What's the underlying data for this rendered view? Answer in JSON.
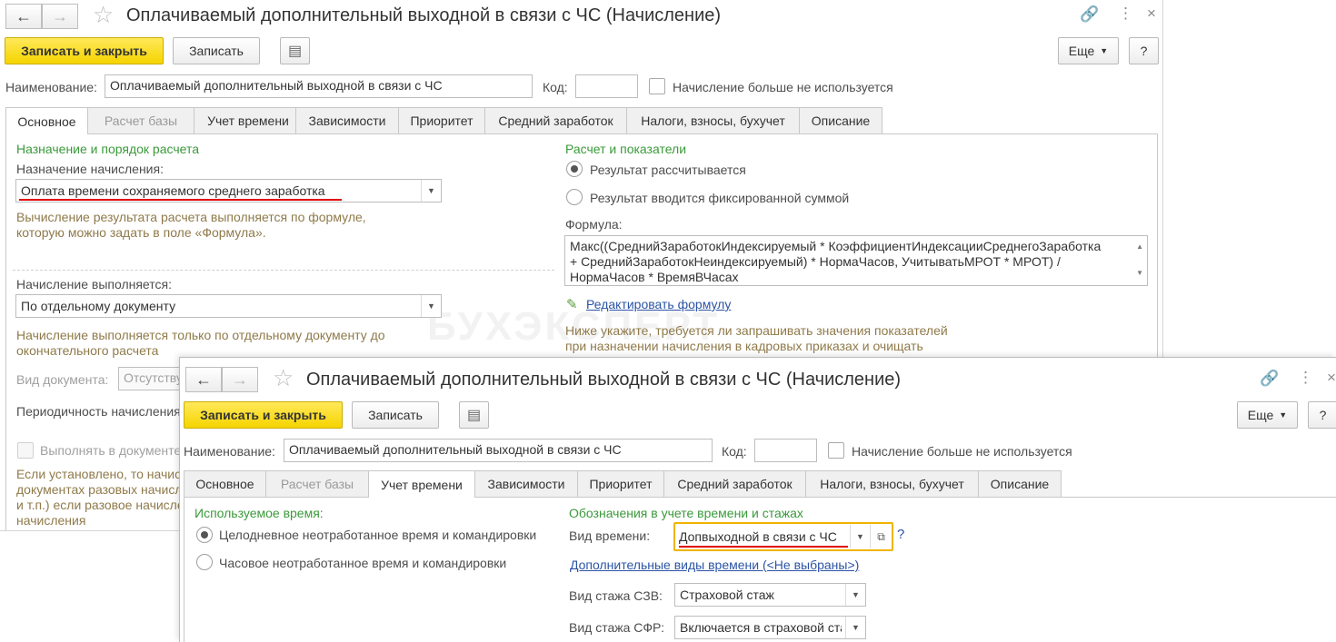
{
  "win1": {
    "title": "Оплачиваемый дополнительный выходной в связи с ЧС (Начисление)",
    "toolbar": {
      "save_close": "Записать и закрыть",
      "save": "Записать",
      "more": "Еще",
      "help": "?"
    },
    "name_label": "Наименование:",
    "name_value": "Оплачиваемый дополнительный выходной в связи с ЧС",
    "code_label": "Код:",
    "code_value": "",
    "unused_label": "Начисление больше не используется",
    "tabs": [
      "Основное",
      "Расчет базы",
      "Учет времени",
      "Зависимости",
      "Приоритет",
      "Средний заработок",
      "Налоги, взносы, бухучет",
      "Описание"
    ],
    "left": {
      "section": "Назначение и порядок расчета",
      "purpose_label": "Назначение начисления:",
      "purpose_value": "Оплата времени сохраняемого среднего заработка",
      "hint1_line1": "Вычисление результата расчета выполняется по формуле,",
      "hint1_line2": "которую можно задать в поле «Формула».",
      "exec_label": "Начисление выполняется:",
      "exec_value": "По отдельному документу",
      "hint2_line1": "Начисление выполняется только по отдельному документу до",
      "hint2_line2": "окончательного расчета",
      "doc_type_label": "Вид документа:",
      "doc_type_value": "Отсутствует",
      "period_label": "Периодичность начисления:",
      "exec_in_doc_label": "Выполнять в документе",
      "hint3_line1": "Если установлено, то начисление",
      "hint3_line2": "документах разовых начислений",
      "hint3_line3": "и т.п.) если разовое начисление",
      "hint3_line4": "начисления"
    },
    "right": {
      "section": "Расчет и показатели",
      "radio1": "Результат рассчитывается",
      "radio2": "Результат вводится фиксированной суммой",
      "formula_label": "Формула:",
      "formula_line1": "Макс((СреднийЗаработокИндексируемый * КоэффициентИндексацииСреднегоЗаработка",
      "formula_line2": "+ СреднийЗаработокНеиндексируемый) * НормаЧасов, УчитыватьМРОТ * МРОТ) /",
      "formula_line3": "НормаЧасов * ВремяВЧасах",
      "edit_formula": "Редактировать формулу",
      "hint_line1": "Ниже укажите, требуется ли запрашивать значения показателей",
      "hint_line2": "при назначении начисления в кадровых приказах и очищать"
    },
    "watermark": "БУХЭКСПЕРТ"
  },
  "win2": {
    "title": "Оплачиваемый дополнительный выходной в связи с ЧС (Начисление)",
    "toolbar": {
      "save_close": "Записать и закрыть",
      "save": "Записать",
      "more": "Еще",
      "help": "?"
    },
    "name_label": "Наименование:",
    "name_value": "Оплачиваемый дополнительный выходной в связи с ЧС",
    "code_label": "Код:",
    "code_value": "",
    "unused_label": "Начисление больше не используется",
    "tabs": [
      "Основное",
      "Расчет базы",
      "Учет времени",
      "Зависимости",
      "Приоритет",
      "Средний заработок",
      "Налоги, взносы, бухучет",
      "Описание"
    ],
    "left": {
      "section": "Используемое время:",
      "radio1": "Целодневное неотработанное время и командировки",
      "radio2": "Часовое неотработанное время и командировки"
    },
    "right": {
      "section": "Обозначения в учете времени и стажах",
      "time_type_label": "Вид времени:",
      "time_type_value": "Допвыходной в связи с ЧС",
      "help_mark": "?",
      "extra_types_link": "Дополнительные виды времени (<Не выбраны>)",
      "szv_label": "Вид стажа СЗВ:",
      "szv_value": "Страховой стаж",
      "sfr_label": "Вид стажа СФР:",
      "sfr_value": "Включается в страховой стаж"
    }
  },
  "colors": {
    "accent_yellow": "#f5d400",
    "section_green": "#3a9a3a",
    "hint_brown": "#8f7a4a",
    "link_blue": "#2b54a5",
    "underline_red": "#e00000",
    "focus_orange": "#f0b400"
  }
}
